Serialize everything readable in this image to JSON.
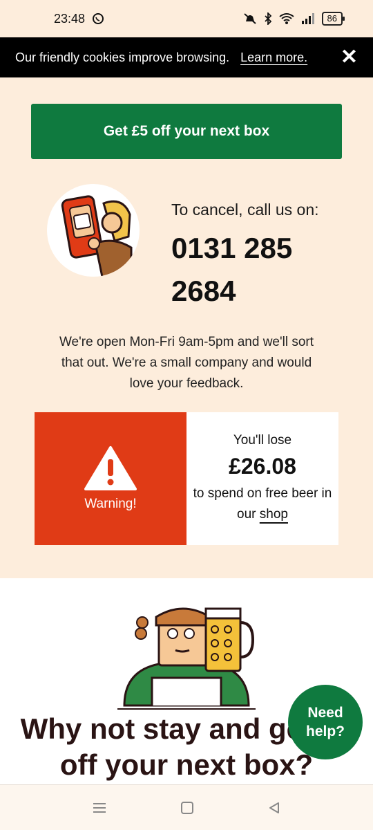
{
  "status": {
    "time": "23:48",
    "battery": "86"
  },
  "cookie": {
    "text": "Our friendly cookies improve browsing.",
    "link": "Learn more.",
    "close": "✕"
  },
  "offer": {
    "label": "Get £5 off your next box"
  },
  "cancel": {
    "label": "To cancel, call us on:",
    "phone": "0131 285 2684"
  },
  "hours": {
    "text": "We're open Mon-Fri 9am-5pm and we'll sort that out. We're a small company and would love your feedback."
  },
  "warning": {
    "label": "Warning!",
    "lose_prefix": "You'll lose",
    "amount": "£26.08",
    "spend_text": "to spend on free beer in our",
    "shop_link": "shop",
    "accent": "#e03b16"
  },
  "promo": {
    "headline": "Why not stay and get £5 off your next box?"
  },
  "help": {
    "label": "Need help?"
  },
  "colors": {
    "brand_green": "#0f7a3f",
    "background": "#fdeddc"
  }
}
